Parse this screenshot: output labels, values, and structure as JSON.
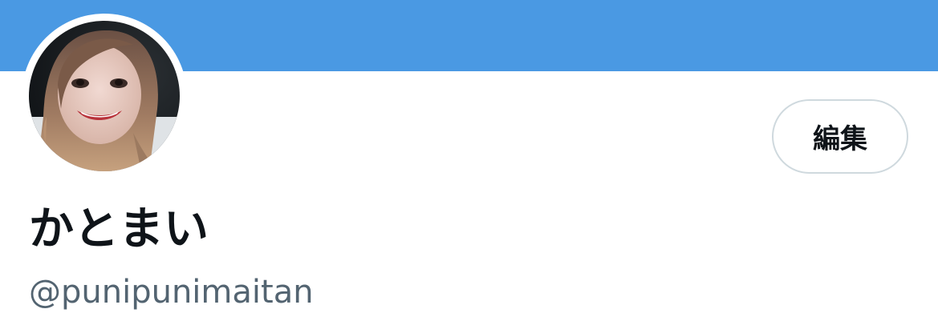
{
  "profile": {
    "display_name": "かとまい",
    "handle": "@punipunimaitan",
    "edit_button_label": "編集"
  },
  "colors": {
    "banner": "#4a99e3",
    "name_text": "#0f1419",
    "handle_text": "#536471",
    "button_border": "#cfd9de"
  }
}
